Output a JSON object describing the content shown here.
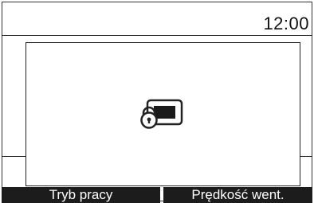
{
  "status_bar": {
    "time": "12:00"
  },
  "dialog": {
    "icon": "screen-lock-icon"
  },
  "softkeys": {
    "left_label": "Tryb pracy",
    "right_label": "Prędkość went."
  },
  "colors": {
    "background": "#ffffff",
    "foreground": "#111111",
    "softkey_background": "#1c1c1c",
    "softkey_text": "#ffffff"
  }
}
